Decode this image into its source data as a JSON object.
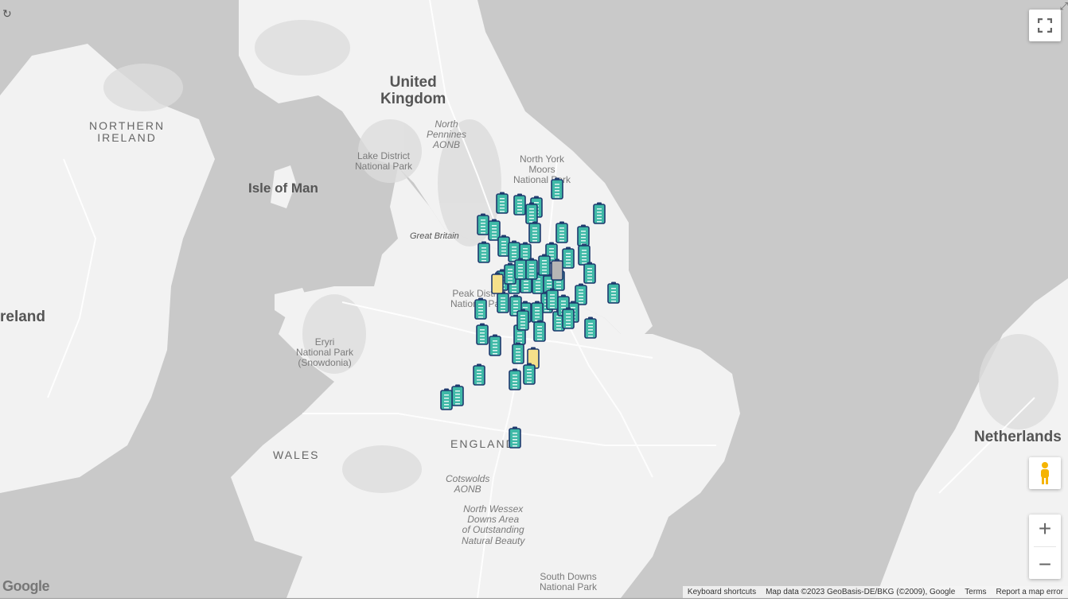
{
  "labels": {
    "united_kingdom": "United\nKingdom",
    "northern_ireland": "NORTHERN\nIRELAND",
    "isle_of_man": "Isle of Man",
    "ireland": "reland",
    "north_pennines": "North\nPennines\nAONB",
    "lake_district": "Lake District\nNational Park",
    "north_york_moors": "North York\nMoors\nNational Park",
    "great_britain": "Great Britain",
    "peak_district": "Peak District\nNational Park",
    "eryri": "Eryri\nNational Park\n(Snowdonia)",
    "wales": "WALES",
    "england": "ENGLAND",
    "netherlands": "Netherlands",
    "cotswolds": "Cotswolds\nAONB",
    "north_wessex": "North Wessex\nDowns Area\nof Outstanding\nNatural Beauty",
    "south_downs": "South Downs\nNational Park"
  },
  "footer": {
    "keyboard": "Keyboard shortcuts",
    "map_data": "Map data ©2023 GeoBasis-DE/BKG (©2009), Google",
    "terms": "Terms",
    "report": "Report a map error"
  },
  "logo": "Google",
  "colors": {
    "water": "#c9c9c9",
    "land": "#f2f2f2",
    "marker_full": "#3fb9a7",
    "marker_border": "#1f3a6e",
    "marker_warn": "#f5e08a",
    "marker_unknown": "#b5b5b5"
  },
  "markers": [
    {
      "id": "m1",
      "status": "full"
    },
    {
      "id": "m2",
      "status": "full"
    },
    {
      "id": "m3",
      "status": "full"
    },
    {
      "id": "m4",
      "status": "full"
    },
    {
      "id": "m5",
      "status": "full"
    },
    {
      "id": "m6",
      "status": "full"
    },
    {
      "id": "m7",
      "status": "full"
    },
    {
      "id": "m8",
      "status": "full"
    },
    {
      "id": "m9",
      "status": "full"
    },
    {
      "id": "m10",
      "status": "full"
    },
    {
      "id": "m11",
      "status": "full"
    },
    {
      "id": "m12",
      "status": "full"
    },
    {
      "id": "m13",
      "status": "full"
    },
    {
      "id": "m14",
      "status": "full"
    },
    {
      "id": "m15",
      "status": "full"
    },
    {
      "id": "m16",
      "status": "full"
    },
    {
      "id": "m17",
      "status": "full"
    },
    {
      "id": "m18",
      "status": "full"
    },
    {
      "id": "m19",
      "status": "full"
    },
    {
      "id": "m20",
      "status": "full"
    },
    {
      "id": "m21",
      "status": "full"
    },
    {
      "id": "m22",
      "status": "full"
    },
    {
      "id": "m23",
      "status": "full"
    },
    {
      "id": "m24",
      "status": "full"
    },
    {
      "id": "m25",
      "status": "full"
    },
    {
      "id": "m26",
      "status": "full"
    },
    {
      "id": "m27",
      "status": "full"
    },
    {
      "id": "m28",
      "status": "full"
    },
    {
      "id": "m29",
      "status": "full"
    },
    {
      "id": "m30",
      "status": "full"
    },
    {
      "id": "m31",
      "status": "full"
    },
    {
      "id": "m32",
      "status": "full"
    },
    {
      "id": "m33",
      "status": "full"
    },
    {
      "id": "m34",
      "status": "full"
    },
    {
      "id": "m35",
      "status": "full"
    },
    {
      "id": "m36",
      "status": "full"
    },
    {
      "id": "m37",
      "status": "full"
    },
    {
      "id": "m38",
      "status": "full"
    },
    {
      "id": "m39",
      "status": "full"
    },
    {
      "id": "m40",
      "status": "full"
    },
    {
      "id": "m41",
      "status": "warn"
    },
    {
      "id": "m42",
      "status": "warn"
    },
    {
      "id": "m43",
      "status": "unknown"
    },
    {
      "id": "m44",
      "status": "full"
    },
    {
      "id": "m45",
      "status": "full"
    },
    {
      "id": "m46",
      "status": "full"
    },
    {
      "id": "m47",
      "status": "full"
    },
    {
      "id": "m48",
      "status": "full"
    },
    {
      "id": "m49",
      "status": "full"
    },
    {
      "id": "m50",
      "status": "full"
    },
    {
      "id": "m51",
      "status": "full"
    },
    {
      "id": "m52",
      "status": "full"
    },
    {
      "id": "m53",
      "status": "full"
    },
    {
      "id": "m54",
      "status": "full"
    },
    {
      "id": "m55",
      "status": "full"
    },
    {
      "id": "m56",
      "status": "full"
    },
    {
      "id": "m57",
      "status": "full"
    },
    {
      "id": "m58",
      "status": "full"
    }
  ]
}
